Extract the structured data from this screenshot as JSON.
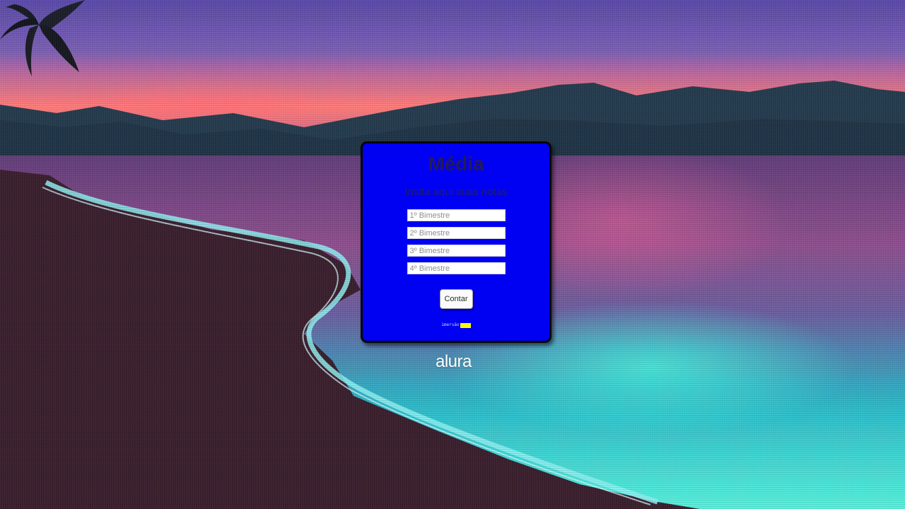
{
  "app": {
    "title": "Média",
    "subtitle": "Insita aqui suas notas"
  },
  "form": {
    "inputs": [
      {
        "value": "",
        "placeholder": "1º Bimestre"
      },
      {
        "value": "",
        "placeholder": "2º Bimestre"
      },
      {
        "value": "",
        "placeholder": "3º Bimestre"
      },
      {
        "value": "",
        "placeholder": "4º Bimestre"
      }
    ],
    "submit_label": "Contar",
    "footer_text": "imersão",
    "footer_badge": ""
  },
  "brand": {
    "logo_text": "alura"
  },
  "colors": {
    "card": "#0000f2",
    "title": "#241a55",
    "button": "#fbfbfb",
    "badge": "#ffff00"
  },
  "icons": [
    "palm-tree-icon"
  ]
}
